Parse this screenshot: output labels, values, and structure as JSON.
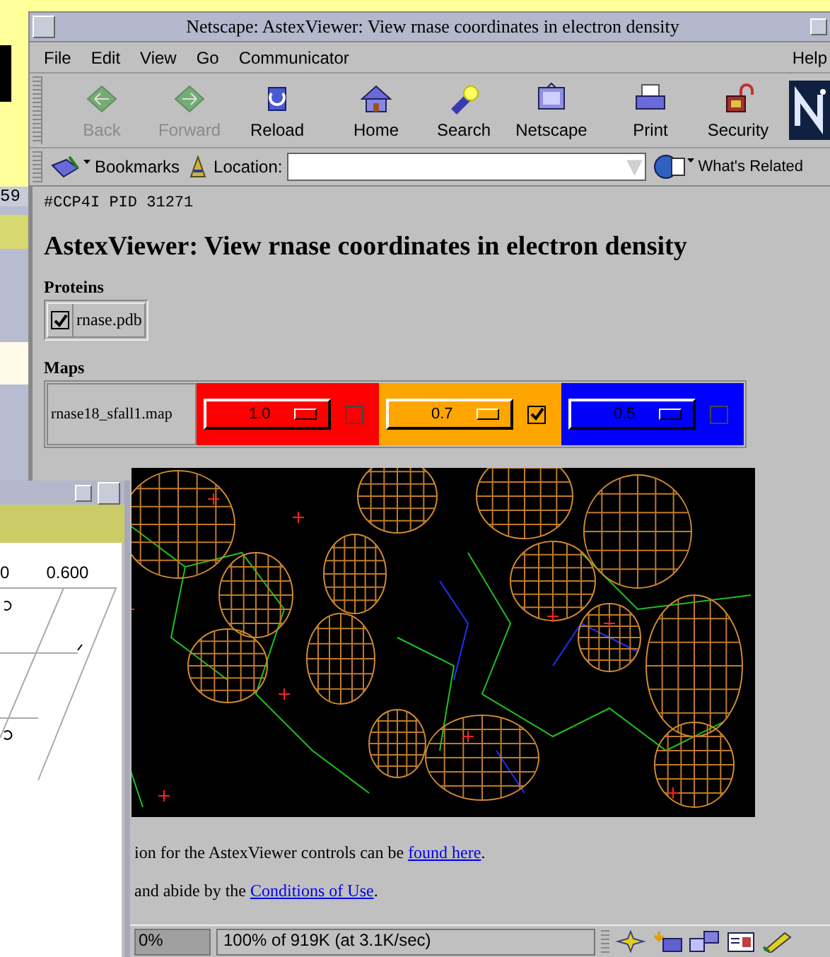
{
  "back_window": {
    "text": "59"
  },
  "browser": {
    "title": "Netscape: AstexViewer: View rnase coordinates in electron density",
    "menu": [
      "File",
      "Edit",
      "View",
      "Go",
      "Communicator"
    ],
    "help_menu": "Help",
    "toolbar": [
      {
        "kind": "back",
        "label": "Back",
        "disabled": true
      },
      {
        "kind": "forward",
        "label": "Forward",
        "disabled": true
      },
      {
        "kind": "reload",
        "label": "Reload",
        "disabled": false
      },
      {
        "kind": "home",
        "label": "Home",
        "disabled": false
      },
      {
        "kind": "search",
        "label": "Search",
        "disabled": false
      },
      {
        "kind": "netscape",
        "label": "Netscape",
        "disabled": false
      },
      {
        "kind": "print",
        "label": "Print",
        "disabled": false
      },
      {
        "kind": "security",
        "label": "Security",
        "disabled": false
      }
    ],
    "location_bar": {
      "bookmarks": "Bookmarks",
      "location_label": "Location:",
      "whats_related": "What's Related"
    },
    "page": {
      "pid_line": "#CCP4I PID 31271",
      "heading": "AstexViewer: View rnase coordinates in electron density",
      "proteins": {
        "heading": "Proteins",
        "items": [
          {
            "name": "rnase.pdb",
            "checked": true
          }
        ]
      },
      "maps": {
        "heading": "Maps",
        "items": [
          {
            "file": "rnase18_sfall1.map",
            "levels": [
              {
                "value": "1.0",
                "color": "#ff0000",
                "checked": false
              },
              {
                "value": "0.7",
                "color": "#ffa500",
                "checked": true
              },
              {
                "value": "0.5",
                "color": "#0000ff",
                "checked": false
              }
            ]
          }
        ]
      },
      "paragraphs": [
        {
          "text": "ion for the AstexViewer controls can be ",
          "link": "found here",
          "tail": "."
        },
        {
          "text": "and abide by the ",
          "link": "Conditions of Use",
          "tail": "."
        }
      ]
    },
    "status_bar": {
      "progress": "0%",
      "message": "100% of 919K (at 3.1K/sec)"
    }
  },
  "plot_window": {
    "axis_labels": [
      "0",
      "0.600"
    ]
  }
}
